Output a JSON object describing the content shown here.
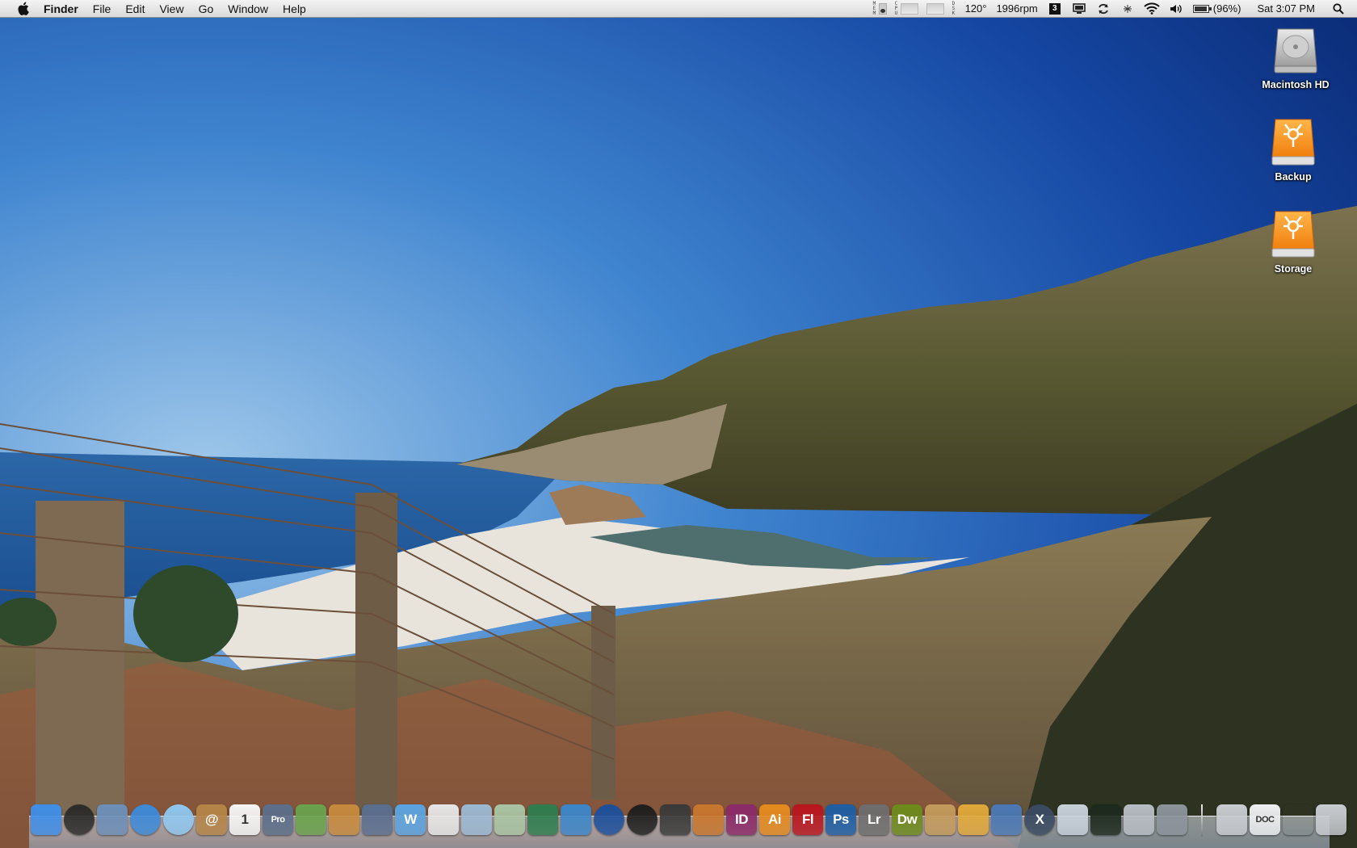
{
  "menubar": {
    "apple_icon": "apple-icon",
    "app_name": "Finder",
    "menus": [
      "File",
      "Edit",
      "View",
      "Go",
      "Window",
      "Help"
    ],
    "status": {
      "temperature": "120°",
      "fan_speed": "1996rpm",
      "battery_percent": "(96%)",
      "clock": "Sat 3:07 PM",
      "icons": [
        "memory-meter-icon",
        "cpu-meter-icon",
        "network-meter-icon",
        "disk-meter-icon",
        "spaces-icon",
        "display-mirroring-icon",
        "time-machine-icon",
        "bluetooth-icon",
        "wifi-icon",
        "volume-icon",
        "battery-icon",
        "spotlight-icon"
      ]
    }
  },
  "desktop": {
    "icons": [
      {
        "label": "Macintosh HD",
        "kind": "internal-hard-drive-icon"
      },
      {
        "label": "Backup",
        "kind": "firewire-drive-icon"
      },
      {
        "label": "Storage",
        "kind": "firewire-drive-icon"
      }
    ]
  },
  "dock": {
    "apps": [
      {
        "name": "finder-icon",
        "text": "",
        "color": "#3f8ee8"
      },
      {
        "name": "dashboard-icon",
        "text": "",
        "color": "#2b2b2b"
      },
      {
        "name": "mail-icon",
        "text": "",
        "color": "#6c8fb8"
      },
      {
        "name": "safari-icon",
        "text": "",
        "color": "#3d8ad8"
      },
      {
        "name": "itunes-icon",
        "text": "",
        "color": "#8fc7ef"
      },
      {
        "name": "address-book-icon",
        "text": "@",
        "color": "#b58447"
      },
      {
        "name": "ical-icon",
        "text": "1",
        "color": "#f5f5f5"
      },
      {
        "name": "final-cut-pro-icon",
        "text": "Pro",
        "color": "#5b6e8a"
      },
      {
        "name": "maps-app-icon",
        "text": "",
        "color": "#69a24d"
      },
      {
        "name": "notes-app-icon",
        "text": "",
        "color": "#c68a3d"
      },
      {
        "name": "script-editor-icon",
        "text": "",
        "color": "#5a6e8f"
      },
      {
        "name": "pages-icon",
        "text": "W",
        "color": "#5aa3e0"
      },
      {
        "name": "textedit-icon",
        "text": "",
        "color": "#e6e6e6"
      },
      {
        "name": "preview-icon",
        "text": "",
        "color": "#9bb9d3"
      },
      {
        "name": "installer-icon",
        "text": "",
        "color": "#a8c4a2"
      },
      {
        "name": "shield-app-icon",
        "text": "",
        "color": "#2e7d4f"
      },
      {
        "name": "network-app-icon",
        "text": "",
        "color": "#3c86c9"
      },
      {
        "name": "google-earth-icon",
        "text": "",
        "color": "#1c4f9c"
      },
      {
        "name": "aperture-icon",
        "text": "",
        "color": "#1e1e1e"
      },
      {
        "name": "system-monitor-icon",
        "text": "",
        "color": "#3a3a3a"
      },
      {
        "name": "iphoto-icon",
        "text": "",
        "color": "#c7762e"
      },
      {
        "name": "indesign-icon",
        "text": "ID",
        "color": "#8b2a68"
      },
      {
        "name": "illustrator-icon",
        "text": "Ai",
        "color": "#e48a1f"
      },
      {
        "name": "flash-icon",
        "text": "Fl",
        "color": "#b9161e"
      },
      {
        "name": "photoshop-icon",
        "text": "Ps",
        "color": "#1e5ea3"
      },
      {
        "name": "lightroom-icon",
        "text": "Lr",
        "color": "#6d6d6d"
      },
      {
        "name": "dreamweaver-icon",
        "text": "Dw",
        "color": "#6d8a1c"
      },
      {
        "name": "photo-viewer-icon",
        "text": "",
        "color": "#c29a5b"
      },
      {
        "name": "transmit-icon",
        "text": "",
        "color": "#e0a83a"
      },
      {
        "name": "remote-desktop-icon",
        "text": "",
        "color": "#4b78b5"
      },
      {
        "name": "mac-os-x-icon",
        "text": "X",
        "color": "#3a4a62"
      },
      {
        "name": "system-profiler-icon",
        "text": "",
        "color": "#c8d0da"
      },
      {
        "name": "activity-monitor-icon",
        "text": "",
        "color": "#1e2a1e"
      },
      {
        "name": "disk-utility-icon",
        "text": "",
        "color": "#b7bdc4"
      },
      {
        "name": "system-preferences-icon",
        "text": "",
        "color": "#8d939b"
      }
    ],
    "stacks": [
      {
        "name": "applications-stack-icon",
        "text": "",
        "color": "#c9ccd1"
      },
      {
        "name": "documents-stack-icon",
        "text": "DOC",
        "color": "#eef0f2"
      },
      {
        "name": "downloads-stack-icon",
        "text": "",
        "color": "#ddd"
      },
      {
        "name": "trash-icon",
        "text": "",
        "color": "#c9cdd2"
      }
    ]
  }
}
